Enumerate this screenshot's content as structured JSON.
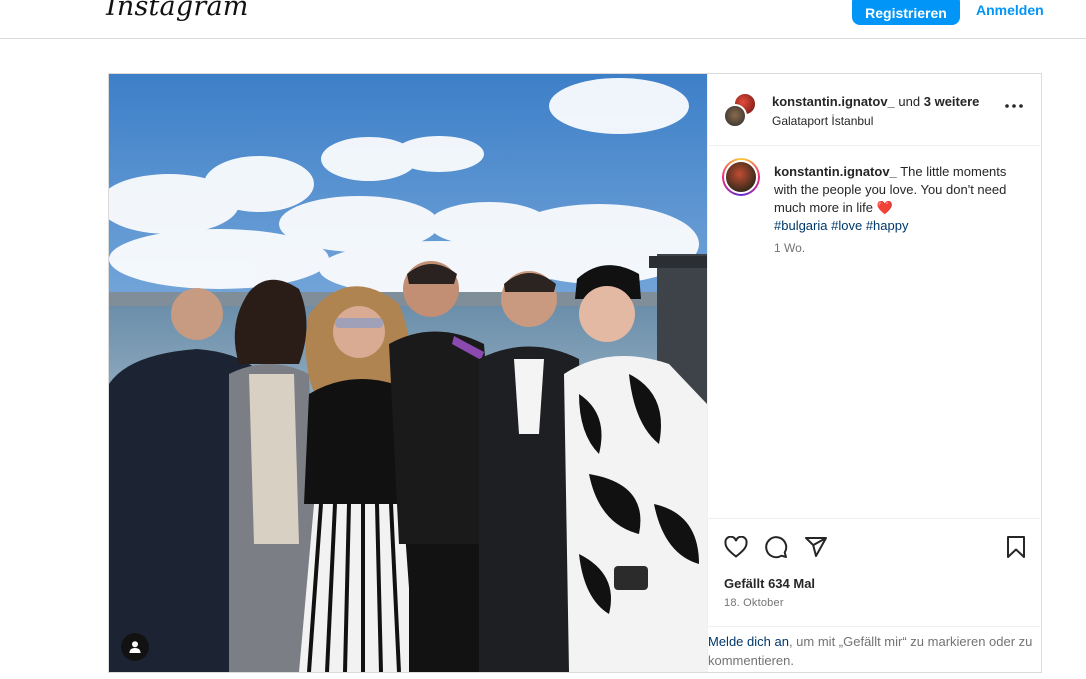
{
  "header": {
    "logo": "Instagram",
    "register_label": "Registrieren",
    "login_label": "Anmelden"
  },
  "post": {
    "author": "konstantin.ignatov_",
    "collab_connector": "und",
    "collab_more": "3 weitere",
    "location": "Galataport İstanbul",
    "caption_user": "konstantin.ignatov_",
    "caption_text": "The little moments with the people you love. You don't need much more in life",
    "caption_emoji": "❤️",
    "hashtags": [
      "#bulgaria",
      "#love",
      "#happy"
    ],
    "age": "1 Wo.",
    "likes": "Gefällt 634 Mal",
    "date": "18. Oktober",
    "login_prompt_link": "Melde dich an",
    "login_prompt_rest": ", um mit „Gefällt mir“ zu markieren oder zu kommentieren."
  },
  "icons": {
    "more": "more-horizontal-icon",
    "like": "heart-icon",
    "comment": "comment-icon",
    "share": "share-icon",
    "save": "bookmark-icon",
    "tag": "user-tag-icon"
  },
  "colors": {
    "brand_blue": "#0095f6",
    "link_dark": "#00376b",
    "muted": "#737373",
    "border": "#dbdbdb"
  }
}
